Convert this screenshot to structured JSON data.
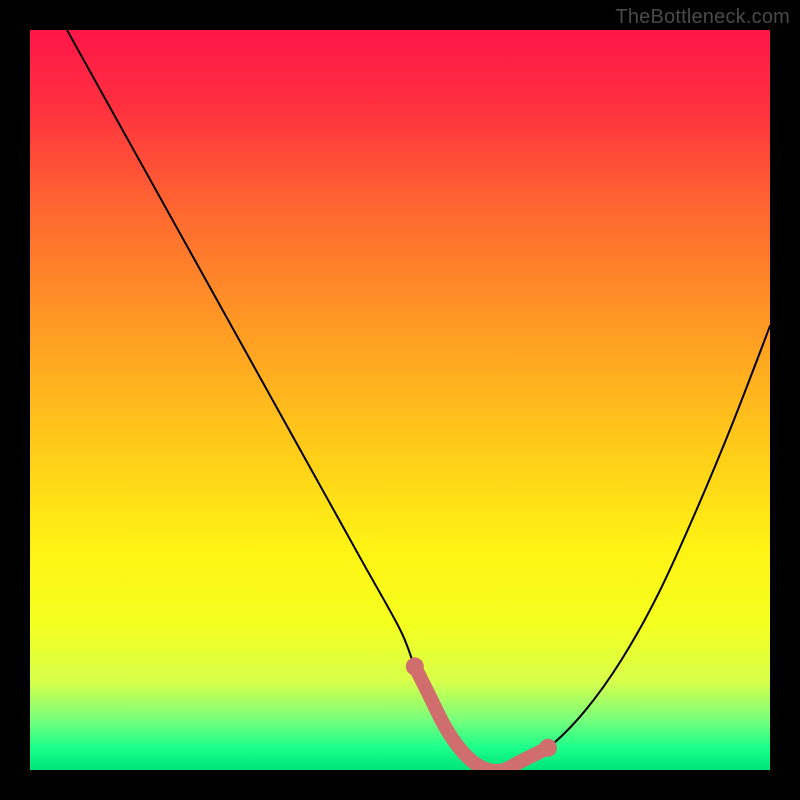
{
  "watermark": "TheBottleneck.com",
  "colors": {
    "frame": "#000000",
    "curve": "#000000",
    "highlight": "#cf6e6c",
    "gradient_stops": [
      {
        "offset": 0.0,
        "color": "#ff1649"
      },
      {
        "offset": 0.1,
        "color": "#ff2f40"
      },
      {
        "offset": 0.25,
        "color": "#ff6a30"
      },
      {
        "offset": 0.4,
        "color": "#ff9a24"
      },
      {
        "offset": 0.55,
        "color": "#ffc71a"
      },
      {
        "offset": 0.7,
        "color": "#fff314"
      },
      {
        "offset": 0.8,
        "color": "#f5ff1e"
      },
      {
        "offset": 0.88,
        "color": "#d8ff4a"
      },
      {
        "offset": 0.93,
        "color": "#7cff7a"
      },
      {
        "offset": 0.97,
        "color": "#1bff8b"
      },
      {
        "offset": 1.0,
        "color": "#00e47a"
      }
    ]
  },
  "chart_data": {
    "type": "line",
    "title": "",
    "xlabel": "",
    "ylabel": "",
    "xrange": [
      0,
      100
    ],
    "yrange": [
      0,
      100
    ],
    "series": [
      {
        "name": "bottleneck-curve",
        "x": [
          5,
          10,
          15,
          20,
          25,
          30,
          35,
          40,
          45,
          50,
          52,
          54,
          56,
          58,
          60,
          62,
          64,
          66,
          70,
          75,
          80,
          85,
          90,
          95,
          100
        ],
        "y": [
          100,
          91,
          82,
          73,
          64,
          55,
          46,
          37,
          28,
          19,
          14,
          10,
          6,
          3,
          1,
          0,
          0,
          1,
          3,
          8,
          15,
          24,
          35,
          47,
          60
        ]
      }
    ],
    "highlight": {
      "name": "sweet-spot",
      "x": [
        52,
        54,
        56,
        58,
        60,
        62,
        64,
        66,
        68,
        70
      ],
      "y": [
        14,
        10,
        6,
        3,
        1,
        0,
        0,
        1,
        2,
        3
      ],
      "dots_at": [
        52,
        70
      ]
    }
  }
}
